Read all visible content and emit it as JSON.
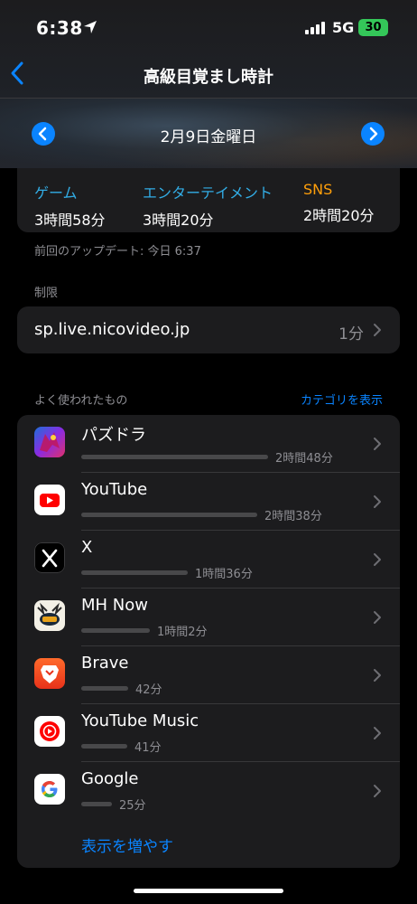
{
  "status": {
    "time": "6:38",
    "network": "5G",
    "battery": "30"
  },
  "nav": {
    "title": "高級目覚まし時計"
  },
  "date": {
    "label": "2月9日金曜日"
  },
  "categories": [
    {
      "name": "ゲーム",
      "time": "3時間58分",
      "color": "#32ade6"
    },
    {
      "name": "エンターテイメント",
      "time": "3時間20分",
      "color": "#32ade6"
    },
    {
      "name": "SNS",
      "time": "2時間20分",
      "color": "#ff9f0a"
    }
  ],
  "update_text": "前回のアップデート: 今日 6:37",
  "limits": {
    "section_label": "制限",
    "site": "sp.live.nicovideo.jp",
    "value": "1分"
  },
  "most_used": {
    "section_label": "よく使われたもの",
    "link": "カテゴリを表示",
    "show_more": "表示を増やす",
    "apps": [
      {
        "name": "パズドラ",
        "time": "2時間48分",
        "minutes": 168,
        "icon": "puzzle-dragons-icon"
      },
      {
        "name": "YouTube",
        "time": "2時間38分",
        "minutes": 158,
        "icon": "youtube-icon"
      },
      {
        "name": "X",
        "time": "1時間36分",
        "minutes": 96,
        "icon": "x-icon"
      },
      {
        "name": "MH Now",
        "time": "1時間2分",
        "minutes": 62,
        "icon": "mh-now-icon"
      },
      {
        "name": "Brave",
        "time": "42分",
        "minutes": 42,
        "icon": "brave-icon"
      },
      {
        "name": "YouTube Music",
        "time": "41分",
        "minutes": 41,
        "icon": "youtube-music-icon"
      },
      {
        "name": "Google",
        "time": "25分",
        "minutes": 25,
        "icon": "google-icon"
      }
    ]
  },
  "colors": {
    "accent": "#0a84ff",
    "card": "#1c1c1e",
    "secondary_text": "#8e8e93"
  }
}
